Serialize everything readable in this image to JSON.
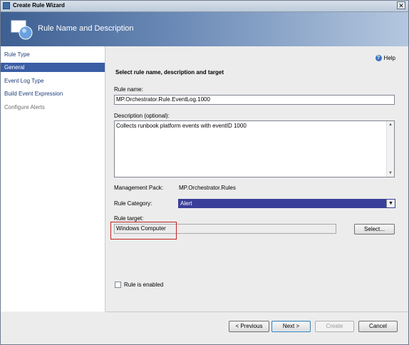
{
  "window": {
    "title": "Create Rule Wizard",
    "close_glyph": "✕"
  },
  "banner": {
    "title": "Rule Name and Description"
  },
  "sidebar": {
    "items": [
      {
        "label": "Rule Type",
        "state": "normal"
      },
      {
        "label": "General",
        "state": "selected"
      },
      {
        "label": "Event Log Type",
        "state": "normal"
      },
      {
        "label": "Build Event Expression",
        "state": "normal"
      },
      {
        "label": "Configure Alerts",
        "state": "disabled"
      }
    ]
  },
  "content": {
    "help_label": "Help",
    "section_title": "Select rule name, description and target",
    "rule_name_label": "Rule name:",
    "rule_name_value": "MP.Orchestrator.Rule.EventLog.1000",
    "description_label": "Description (optional):",
    "description_value": "Collects runbook platform events with eventID 1000",
    "management_pack_label": "Management Pack:",
    "management_pack_value": "MP.Orchestrator.Rules",
    "rule_category_label": "Rule Category:",
    "rule_category_value": "Alert",
    "rule_target_label": "Rule target:",
    "rule_target_value": "Windows Computer",
    "select_button": "Select...",
    "enabled_label": "Rule is enabled",
    "enabled_checked": false
  },
  "footer": {
    "previous": "< Previous",
    "next": "Next >",
    "create": "Create",
    "cancel": "Cancel"
  },
  "colors": {
    "selection": "#3a5da5",
    "highlight_box": "#c42020"
  }
}
